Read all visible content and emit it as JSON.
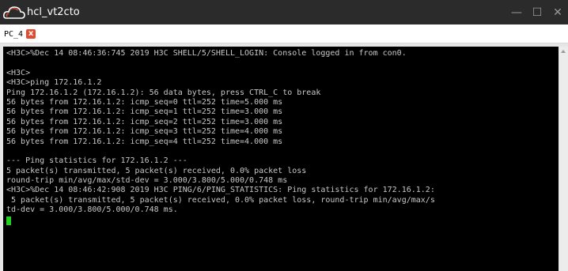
{
  "window": {
    "title": "hcl_vt2cto",
    "minimize_glyph": "—",
    "maximize_glyph": "☐",
    "close_glyph": "✕"
  },
  "tab": {
    "label": "PC_4",
    "close_glyph": "x"
  },
  "terminal": {
    "lines": [
      "<H3C>%Dec 14 08:46:36:745 2019 H3C SHELL/5/SHELL_LOGIN: Console logged in from con0.",
      "",
      "<H3C>",
      "<H3C>ping 172.16.1.2",
      "Ping 172.16.1.2 (172.16.1.2): 56 data bytes, press CTRL_C to break",
      "56 bytes from 172.16.1.2: icmp_seq=0 ttl=252 time=5.000 ms",
      "56 bytes from 172.16.1.2: icmp_seq=1 ttl=252 time=3.000 ms",
      "56 bytes from 172.16.1.2: icmp_seq=2 ttl=252 time=3.000 ms",
      "56 bytes from 172.16.1.2: icmp_seq=3 ttl=252 time=4.000 ms",
      "56 bytes from 172.16.1.2: icmp_seq=4 ttl=252 time=4.000 ms",
      "",
      "--- Ping statistics for 172.16.1.2 ---",
      "5 packet(s) transmitted, 5 packet(s) received, 0.0% packet loss",
      "round-trip min/avg/max/std-dev = 3.000/3.800/5.000/0.748 ms",
      "<H3C>%Dec 14 08:46:42:908 2019 H3C PING/6/PING_STATISTICS: Ping statistics for 172.16.1.2:",
      " 5 packet(s) transmitted, 5 packet(s) received, 0.0% packet loss, round-trip min/avg/max/s",
      "td-dev = 3.000/3.800/5.000/0.748 ms."
    ],
    "text_color": "#c8c8c8",
    "background": "#000000",
    "cursor_color": "#1fd21f"
  },
  "icons": {
    "app": "cloud-icon",
    "tab_close": "close-icon"
  }
}
